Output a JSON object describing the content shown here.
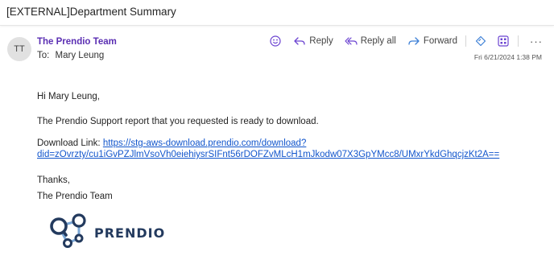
{
  "subject": "[EXTERNAL]Department Summary",
  "sender": {
    "initials": "TT",
    "name": "The Prendio Team",
    "to_label": "To:",
    "to_name": "Mary Leung"
  },
  "actions": {
    "reply": "Reply",
    "reply_all": "Reply all",
    "forward": "Forward",
    "more": "···"
  },
  "date": "Fri 6/21/2024 1:38 PM",
  "body": {
    "greeting": "Hi Mary Leung,",
    "ready_text": "The Prendio Support report that you requested is ready to download.",
    "download_label": "Download Link: ",
    "download_url": "https://stg-aws-download.prendio.com/download?did=zOvrzty/cu1iGvPZJlmVsoVh0eiehiysrSIFnt56rDOFZvMLcH1mJkodw07X3GpYMcc8/UMxrYkdGhqcjzKt2A==",
    "thanks": "Thanks,",
    "signature": "The Prendio Team"
  },
  "logo": {
    "text": "PRENDIO",
    "color": "#233a5e",
    "accent": "#7aa7d6"
  },
  "colors": {
    "sender": "#5b2fb3",
    "link": "#1155cc",
    "icon_purple": "#6b43d1",
    "icon_blue": "#3c7fd6"
  }
}
